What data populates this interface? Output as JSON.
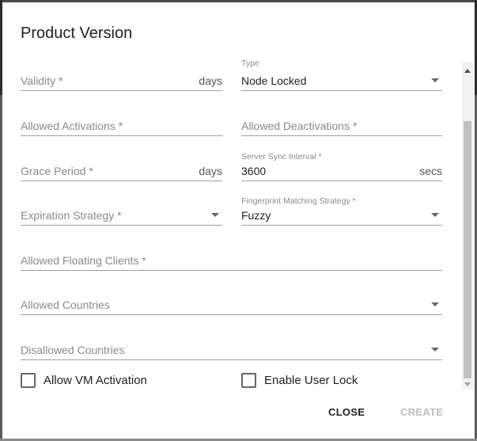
{
  "dialog": {
    "title": "Product Version"
  },
  "fields": {
    "validity": {
      "placeholder": "Validity *",
      "suffix": "days"
    },
    "type": {
      "label": "Type",
      "value": "Node Locked"
    },
    "allowed_activations": {
      "placeholder": "Allowed Activations *"
    },
    "allowed_deactivations": {
      "placeholder": "Allowed Deactivations *"
    },
    "grace_period": {
      "placeholder": "Grace Period *",
      "suffix": "days"
    },
    "server_sync_interval": {
      "label": "Server Sync Interval *",
      "value": "3600",
      "suffix": "secs"
    },
    "expiration_strategy": {
      "placeholder": "Expiration Strategy *"
    },
    "fingerprint_matching_strategy": {
      "label": "Fingerprint Matching Strategy *",
      "value": "Fuzzy"
    },
    "allowed_floating_clients": {
      "placeholder": "Allowed Floating Clients *"
    },
    "allowed_countries": {
      "placeholder": "Allowed Countries"
    },
    "disallowed_countries": {
      "placeholder": "Disallowed Countries"
    }
  },
  "checkboxes": {
    "allow_vm_activation": {
      "label": "Allow VM Activation",
      "checked": false
    },
    "enable_user_lock": {
      "label": "Enable User Lock",
      "checked": false
    }
  },
  "actions": {
    "close_label": "CLOSE",
    "create_label": "CREATE"
  },
  "icons": {
    "dropdown": "chevron-down-icon",
    "scroll_up": "arrow-up-icon",
    "scroll_down": "arrow-down-icon"
  },
  "colors": {
    "disabled_text": "#bdbdbd",
    "underline": "#9e9e9e",
    "placeholder": "#8a8a8a"
  }
}
